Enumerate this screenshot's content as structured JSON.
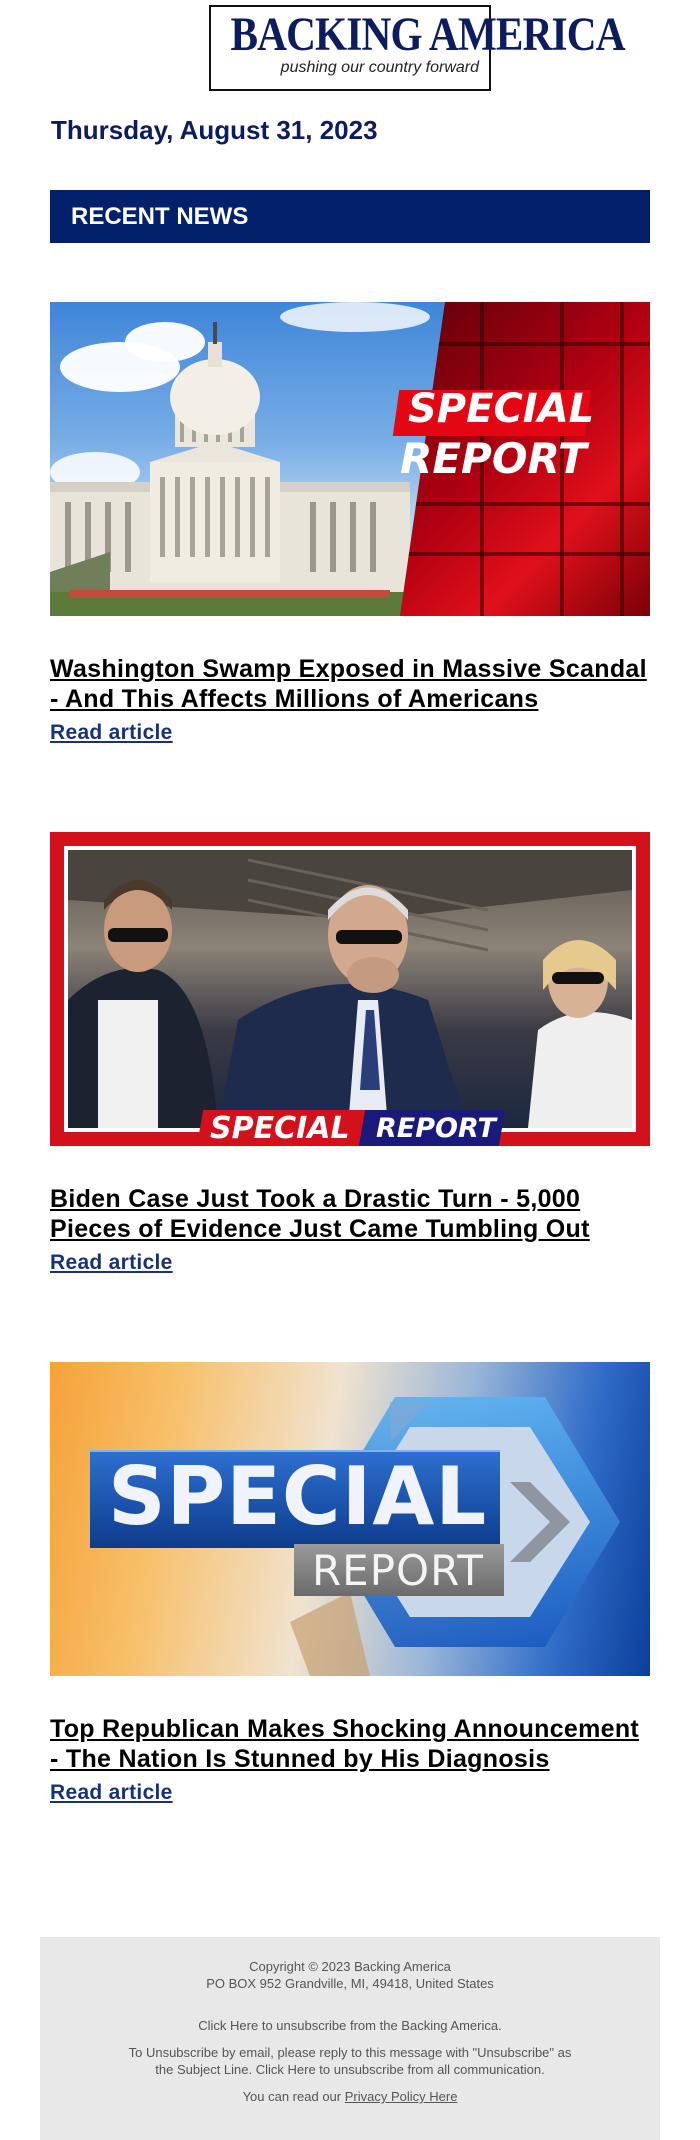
{
  "brand": {
    "name": "BACKING AMERICA",
    "tagline": "pushing our country forward"
  },
  "date": "Thursday, August 31, 2023",
  "section_title": "RECENT NEWS",
  "articles": [
    {
      "title": "Washington Swamp Exposed in Massive Scandal - And This Affects Millions of Americans",
      "link_label": "Read article",
      "image_text": [
        "SPECIAL",
        "REPORT"
      ]
    },
    {
      "title": "Biden Case Just Took a Drastic Turn - 5,000 Pieces of Evidence Just Came Tumbling Out",
      "link_label": "Read article",
      "image_text": [
        "SPECIAL",
        "REPORT"
      ]
    },
    {
      "title": "Top Republican Makes Shocking Announcement - The Nation Is Stunned by His Diagnosis",
      "link_label": "Read article",
      "image_text": [
        "SPECIAL",
        "REPORT"
      ]
    }
  ],
  "footer": {
    "copyright": "Copyright © 2023 Backing America",
    "address": "PO BOX 952 Grandville, MI, 49418, United States",
    "unsubscribe_line": "Click Here to unsubscribe from the Backing America.",
    "email_unsub_line1": "To Unsubscribe by email, please reply to this message with \"Unsubscribe\" as",
    "email_unsub_line2": "the Subject Line. Click Here to unsubscribe from all communication.",
    "privacy_prefix": "You can read our",
    "privacy_link": "Privacy Policy Here"
  },
  "colors": {
    "navy": "#0d1c5e",
    "bar": "#03216b",
    "link": "#18327a",
    "footer_bg": "#e8e8e8"
  }
}
